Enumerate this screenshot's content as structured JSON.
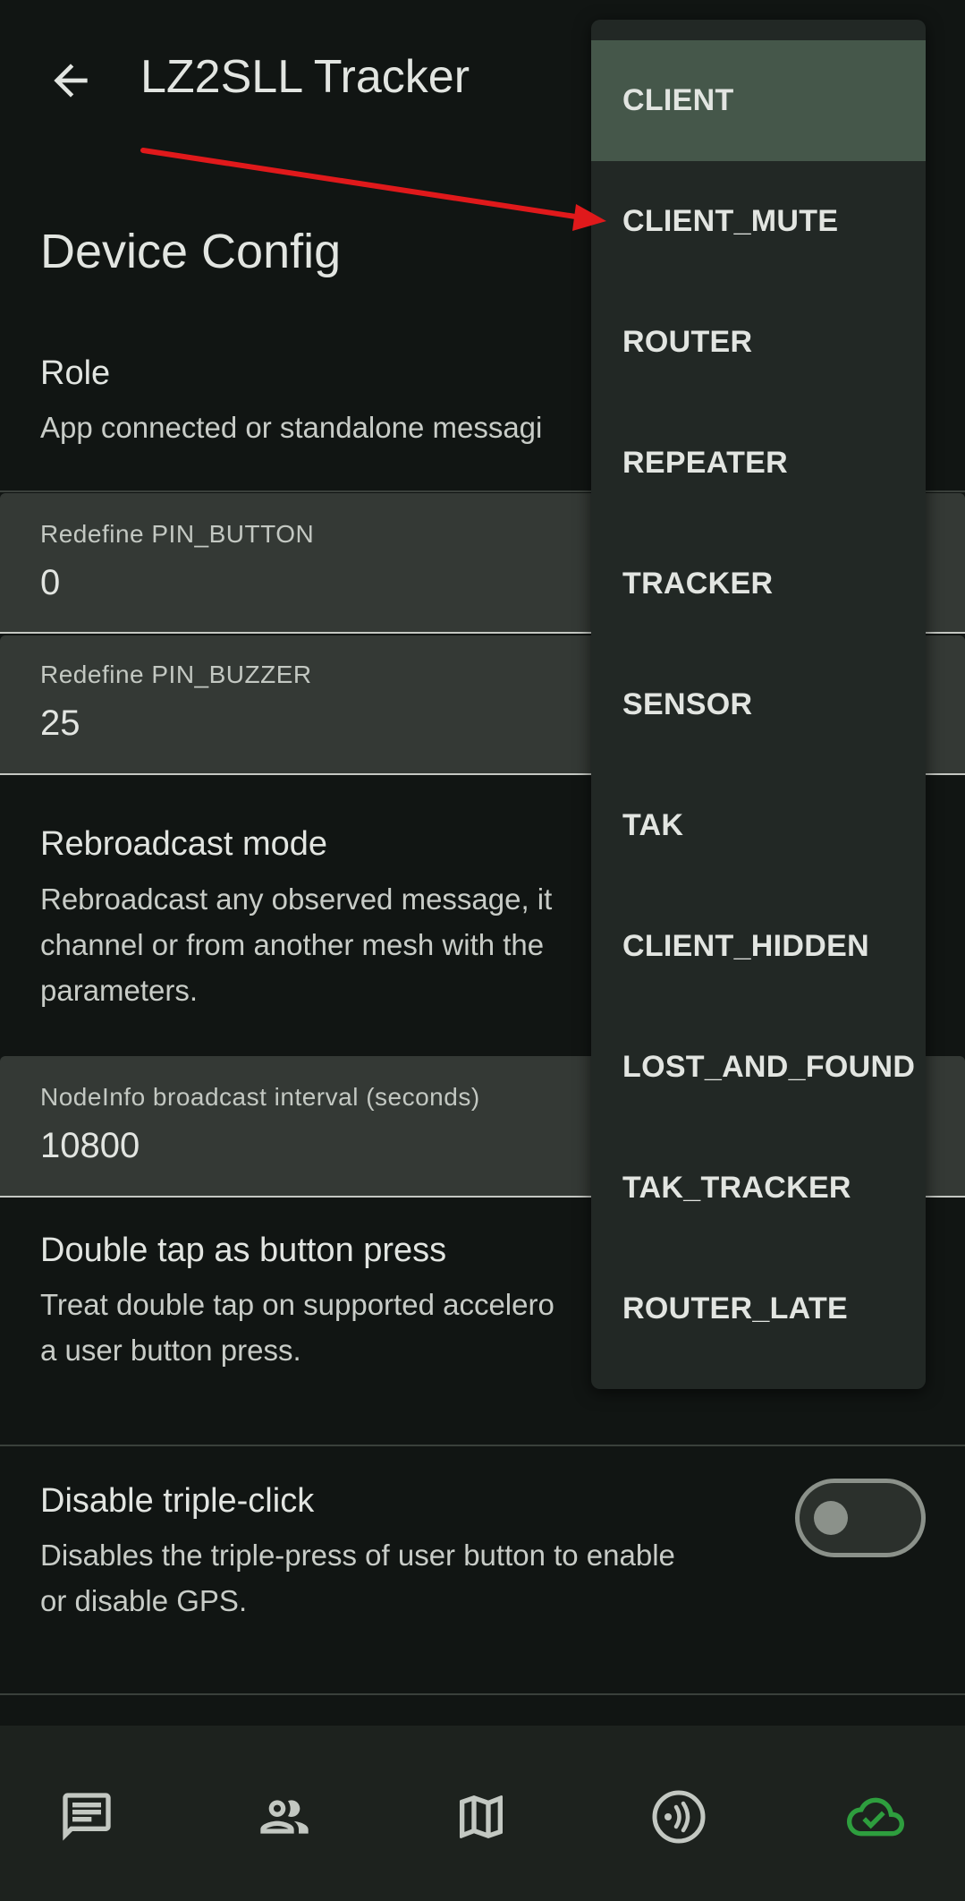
{
  "header": {
    "title": "LZ2SLL Tracker",
    "back_icon": "arrow-back-icon"
  },
  "section": {
    "title": "Device Config"
  },
  "settings": {
    "role": {
      "title": "Role",
      "description": "App connected or standalone messagi"
    },
    "pin_button": {
      "label": "Redefine PIN_BUTTON",
      "value": "0"
    },
    "pin_buzzer": {
      "label": "Redefine PIN_BUZZER",
      "value": "25"
    },
    "rebroadcast": {
      "title": "Rebroadcast mode",
      "desc_lines": [
        "Rebroadcast any observed message, it",
        "channel or from another mesh with the",
        "parameters."
      ]
    },
    "nodeinfo": {
      "label": "NodeInfo broadcast interval (seconds)",
      "value": "10800"
    },
    "double_tap": {
      "title": "Double tap as button press",
      "desc_lines": [
        "Treat double tap on supported accelero",
        "a user button press."
      ]
    },
    "triple_click": {
      "title": "Disable triple-click",
      "desc_lines": [
        "Disables the triple-press of user button to enable",
        "or disable GPS."
      ],
      "enabled": false
    }
  },
  "role_menu": {
    "selected": "CLIENT",
    "options": [
      "CLIENT",
      "CLIENT_MUTE",
      "ROUTER",
      "REPEATER",
      "TRACKER",
      "SENSOR",
      "TAK",
      "CLIENT_HIDDEN",
      "LOST_AND_FOUND",
      "TAK_TRACKER",
      "ROUTER_LATE"
    ]
  },
  "bottom_nav": {
    "items": [
      {
        "icon": "messages-icon"
      },
      {
        "icon": "contacts-icon"
      },
      {
        "icon": "map-icon"
      },
      {
        "icon": "channel-icon"
      },
      {
        "icon": "cloud-connected-icon",
        "color": "#2e9e3e"
      }
    ]
  },
  "colors": {
    "background": "#111513",
    "menu_selected": "#45574a",
    "annotation_arrow": "#e0191b",
    "connected_green": "#2e9e3e"
  }
}
